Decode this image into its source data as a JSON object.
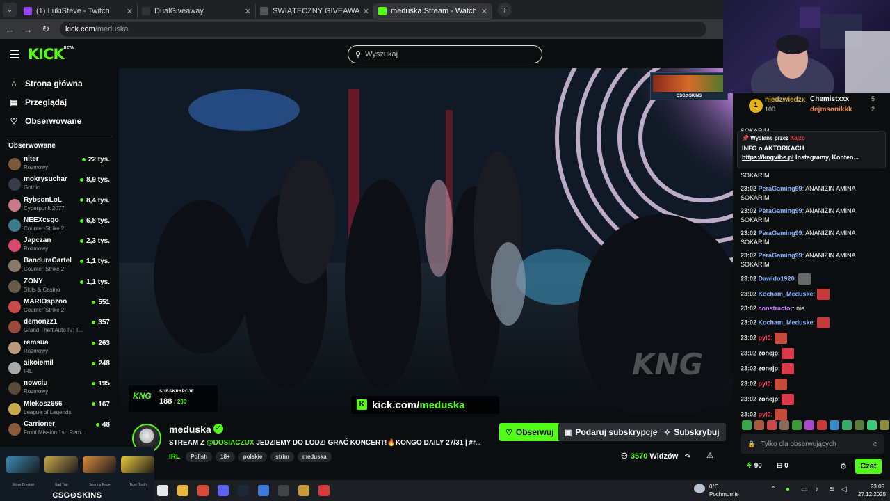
{
  "browser": {
    "tabs": [
      {
        "title": "(1) LukiSteve - Twitch",
        "favicon_color": "#9146ff",
        "active": false
      },
      {
        "title": "DualGiveaway",
        "favicon_color": "#333333",
        "active": false
      },
      {
        "title": "ŚWIĄTECZNY GIVEAWAY",
        "favicon_color": "#555555",
        "active": false
      },
      {
        "title": "meduska Stream - Watch Li",
        "favicon_color": "#53fc18",
        "active": true
      }
    ],
    "url_host": "kick.com",
    "url_path": "/meduska"
  },
  "header": {
    "logo": "KICK",
    "logo_badge": "BETA",
    "search_placeholder": "Wyszukaj"
  },
  "sidebar": {
    "nav": [
      {
        "label": "Strona główna",
        "icon": "home-icon",
        "glyph": "⌂"
      },
      {
        "label": "Przeglądaj",
        "icon": "browse-icon",
        "glyph": "▤"
      },
      {
        "label": "Obserwowane",
        "icon": "heart-icon",
        "glyph": "♡"
      }
    ],
    "followed_heading": "Obserwowane",
    "followed": [
      {
        "name": "niter",
        "category": "Rozmowy",
        "viewers": "22 tys.",
        "color": "#7a5a3a"
      },
      {
        "name": "mokrysuchar",
        "category": "Gothic",
        "viewers": "8,9 tys.",
        "color": "#3a3a4a"
      },
      {
        "name": "RybsonLoL",
        "category": "Cyberpunk 2077",
        "viewers": "8,4 tys.",
        "color": "#c87a8a"
      },
      {
        "name": "NEEXcsgo",
        "category": "Counter-Strike 2",
        "viewers": "6,8 tys.",
        "color": "#3a7a8a"
      },
      {
        "name": "Japczan",
        "category": "Rozmowy",
        "viewers": "2,3 tys.",
        "color": "#d84a6a"
      },
      {
        "name": "BanduraCartel",
        "category": "Counter-Strike 2",
        "viewers": "1,1 tys.",
        "color": "#8a7a6a"
      },
      {
        "name": "ZONY",
        "category": "Slots & Casino",
        "viewers": "1,1 tys.",
        "color": "#6a5a4a"
      },
      {
        "name": "MARIOspzoo",
        "category": "Counter-Strike 2",
        "viewers": "551",
        "color": "#c84a4a"
      },
      {
        "name": "demonzz1",
        "category": "Grand Theft Auto IV: T...",
        "viewers": "357",
        "color": "#9a4a3a"
      },
      {
        "name": "remsua",
        "category": "Rozmowy",
        "viewers": "263",
        "color": "#b89a7a"
      },
      {
        "name": "aikoiemil",
        "category": "IRL",
        "viewers": "248",
        "color": "#aaaaaa"
      },
      {
        "name": "nowciu",
        "category": "Rozmowy",
        "viewers": "195",
        "color": "#5a4a3a"
      },
      {
        "name": "Mlekosz666",
        "category": "League of Legends",
        "viewers": "167",
        "color": "#c8a84a"
      },
      {
        "name": "Carrioner",
        "category": "Front Mission 1st: Rem...",
        "viewers": "48",
        "color": "#8a5a3a"
      }
    ]
  },
  "video": {
    "sub_label": "SUBSKRYPCJE",
    "sub_count": "188",
    "sub_total": "/ 200",
    "sub_logo": "KNG",
    "overlay_url_prefix": "kick.com/",
    "overlay_url_channel": "meduska",
    "top_ad_text": "CSG⊙SKINS"
  },
  "stream": {
    "channel": "meduska",
    "title_prefix": "STREAM Z ",
    "title_mention": "@DOSIACZUX",
    "title_rest": " JEDZIEMY DO LODZI GRAĆ KONCERT!🔥KONGO DAILY 27/31 | #r...",
    "category": "IRL",
    "tags": [
      "Polish",
      "18+",
      "polskie",
      "strim",
      "meduska"
    ],
    "follow_label": "Obserwuj",
    "gift_label": "Podaruj subskrypcje",
    "subscribe_label": "Subskrybuj",
    "viewers_count": "3570",
    "viewers_label": "Widzów"
  },
  "chat": {
    "leaderboard": [
      {
        "rank": "1",
        "name": "niedzwiedzx",
        "value": "100"
      },
      {
        "name": "Chemistxxx",
        "value": "5"
      },
      {
        "name": "dejmsonikkk",
        "value": "2"
      }
    ],
    "pinned_by_label": "Wysłane przez",
    "pinned_by_user": "Kajzo",
    "pinned_line1": "INFO o AKTORKACH",
    "pinned_link": "https://kngvibe.pl",
    "pinned_rest": " Instagramy, Konten...",
    "top_fragment": "SOKARIM",
    "messages": [
      {
        "time": "",
        "user": "",
        "text": "SOKARIM",
        "color": "#ffffff"
      },
      {
        "time": "23:02",
        "user": "PeraGaming99",
        "text": ": ANANIZIN AMINA SOKARIM",
        "color": "#8ab4ff"
      },
      {
        "time": "23:02",
        "user": "PeraGaming99",
        "text": ": ANANIZIN AMINA SOKARIM",
        "color": "#8ab4ff"
      },
      {
        "time": "23:02",
        "user": "PeraGaming99",
        "text": ": ANANIZIN AMINA SOKARIM",
        "color": "#8ab4ff"
      },
      {
        "time": "23:02",
        "user": "PeraGaming99",
        "text": ": ANANIZIN AMINA SOKARIM",
        "color": "#8ab4ff"
      },
      {
        "time": "23:02",
        "user": "Dawido1920",
        "text": ":",
        "color": "#8ab4ff",
        "emote": "#6a6a6a"
      },
      {
        "time": "23:02",
        "user": "Kocham_Meduske",
        "text": ":",
        "color": "#8ab4ff",
        "emote": "#c83a3a"
      },
      {
        "time": "23:02",
        "user": "constractor",
        "text": ": nie",
        "color": "#c878ff"
      },
      {
        "time": "23:02",
        "user": "Kocham_Meduske",
        "text": ":",
        "color": "#8ab4ff",
        "emote": "#c83a3a"
      },
      {
        "time": "23:02",
        "user": "pyl0",
        "text": ":",
        "color": "#ff4a6a",
        "emote": "#c84a3a"
      },
      {
        "time": "23:02",
        "user": "zonejp",
        "text": ":",
        "color": "#ffffff",
        "emote": "#d83a4a"
      },
      {
        "time": "23:02",
        "user": "zonejp",
        "text": ":",
        "color": "#ffffff",
        "emote": "#d83a4a"
      },
      {
        "time": "23:02",
        "user": "pyl0",
        "text": ":",
        "color": "#ff4a6a",
        "emote": "#c84a3a"
      },
      {
        "time": "23:02",
        "user": "zonejp",
        "text": ":",
        "color": "#ffffff",
        "emote": "#d83a4a"
      },
      {
        "time": "23:02",
        "user": "pyl0",
        "text": ":",
        "color": "#ff4a6a",
        "emote": "#c84a3a"
      }
    ],
    "emote_colors": [
      "#3aa84a",
      "#aa5a3a",
      "#c84a4a",
      "#8a6a5a",
      "#3a9a3a",
      "#a84ac8",
      "#c83a3a",
      "#3a8ac8",
      "#3aa86a",
      "#5a7a3a",
      "#3ac87a",
      "#8a8a3a"
    ],
    "input_placeholder": "Tylko dla obserwujących",
    "points": "90",
    "count": "0",
    "send_label": "Czat"
  },
  "ad": {
    "guns": [
      "Wave Breaker",
      "Bad Trip",
      "Searing Rage",
      "Tiger Tooth"
    ],
    "gun_colors": [
      "#3a8ab8",
      "#c8a84a",
      "#d88a3a",
      "#e8c83a"
    ],
    "brand": "CSG⊙SKINS"
  },
  "taskbar": {
    "icon_colors": [
      "#e8e8e8",
      "#e8b83a",
      "#d84a3a",
      "#5865f2",
      "#1b2838",
      "#3a7ad8",
      "#444444",
      "#c89a3a",
      "#d83a3a"
    ],
    "weather_temp": "0°C",
    "weather_desc": "Pochmurnie",
    "time": "23:05",
    "date": "27.12.2025"
  }
}
